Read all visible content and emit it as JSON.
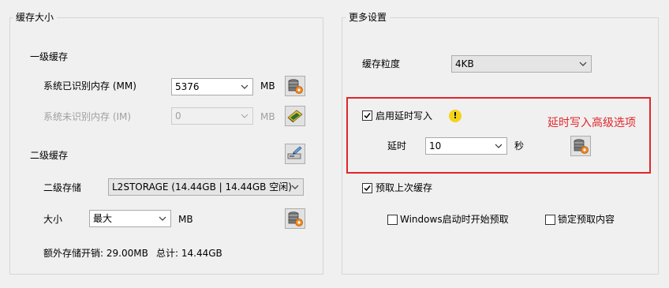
{
  "cache_size": {
    "title": "缓存大小",
    "level1": {
      "heading": "一级缓存",
      "recognized_label": "系统已识别内存 (MM)",
      "recognized_value": "5376",
      "recognized_unit": "MB",
      "unrecognized_label": "系统未识别内存 (IM)",
      "unrecognized_value": "0",
      "unrecognized_unit": "MB"
    },
    "level2": {
      "heading": "二级缓存",
      "storage_label": "二级存储",
      "storage_value": "L2STORAGE (14.44GB | 14.44GB 空闲)",
      "size_label": "大小",
      "size_value": "最大",
      "size_unit": "MB",
      "overhead_text": "额外存储开销: 29.00MB",
      "total_text": "总计: 14.44GB"
    }
  },
  "more_settings": {
    "title": "更多设置",
    "granularity_label": "缓存粒度",
    "granularity_value": "4KB",
    "delayed_write_label": "启用延时写入",
    "delayed_write_checked": true,
    "delay_label": "延时",
    "delay_value": "10",
    "delay_unit": "秒",
    "annotation": "延时写入高级选项",
    "prefetch_label": "预取上次缓存",
    "prefetch_checked": true,
    "prefetch_on_startup_label": "Windows启动时开始预取",
    "prefetch_on_startup_checked": false,
    "lock_prefetch_label": "锁定预取内容",
    "lock_prefetch_checked": false
  },
  "colors": {
    "annotation_red": "#e0262b",
    "warning_yellow": "#f5d21a",
    "disk_orange": "#f08a24"
  },
  "icons": {
    "chevron": "chevron-down-icon",
    "disk_settings": "disk-settings-icon",
    "memory_settings": "memory-chip-icon",
    "storage_edit": "storage-edit-icon",
    "warning": "warning-icon",
    "check": "check-icon"
  }
}
